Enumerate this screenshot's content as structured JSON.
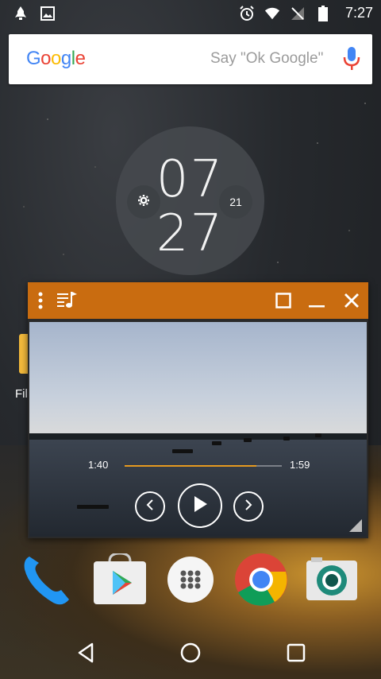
{
  "status_bar": {
    "time": "7:27",
    "left_icons": [
      "notification-rocket-icon",
      "image-icon"
    ],
    "right_icons": [
      "alarm-icon",
      "wifi-icon",
      "no-signal-icon",
      "battery-icon"
    ]
  },
  "search_widget": {
    "logo": "Google",
    "hint": "Say \"Ok Google\""
  },
  "clock_widget": {
    "hours": "07",
    "minutes": "27",
    "date_day": "21"
  },
  "home_folder": {
    "label": "Fil"
  },
  "floating_player": {
    "time_elapsed": "1:40",
    "time_total": "1:59",
    "progress_fraction": 0.84,
    "accent_color": "#c96c10"
  },
  "dock": {
    "apps": [
      "phone",
      "play-store",
      "app-drawer",
      "chrome",
      "camera"
    ]
  },
  "colors": {
    "titlebar": "#c96c10",
    "progress": "#e69a1f"
  }
}
